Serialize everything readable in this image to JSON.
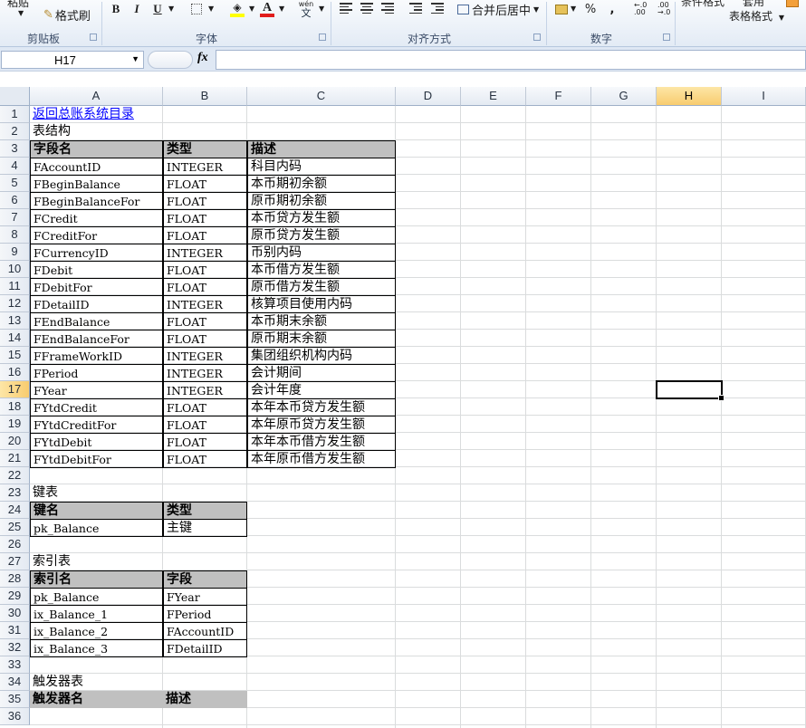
{
  "ribbon": {
    "paste_label": "粘贴",
    "format_painter_label": "格式刷",
    "bold": "B",
    "italic": "I",
    "underline": "U",
    "font_color_glyph": "A",
    "phonetic_glyph": "wén",
    "merge_center_label": "合并后居中",
    "percent": "%",
    "comma": ",",
    "cond_format_label": "条件格式",
    "apply_label": "套用",
    "table_format_label": "表格格式",
    "groups": {
      "clipboard": "剪贴板",
      "font": "字体",
      "alignment": "对齐方式",
      "number": "数字"
    }
  },
  "formula_bar": {
    "name_box": "H17",
    "fx": "fx",
    "formula": ""
  },
  "columns": [
    "A",
    "B",
    "C",
    "D",
    "E",
    "F",
    "G",
    "H",
    "I"
  ],
  "selected_column": "H",
  "selected_row": 17,
  "rows": [
    "1",
    "2",
    "3",
    "4",
    "5",
    "6",
    "7",
    "8",
    "9",
    "10",
    "11",
    "12",
    "13",
    "14",
    "15",
    "16",
    "17",
    "18",
    "19",
    "20",
    "21",
    "22",
    "23",
    "24",
    "25",
    "26",
    "27",
    "28",
    "29",
    "30",
    "31",
    "32",
    "33",
    "34",
    "35",
    "36"
  ],
  "sheet": {
    "link": "返回总账系统目录",
    "structure_title": "表结构",
    "structure_headers": [
      "字段名",
      "类型",
      "描述"
    ],
    "structure_rows": [
      [
        "FAccountID",
        "INTEGER",
        "科目内码"
      ],
      [
        "FBeginBalance",
        "FLOAT",
        "本币期初余额"
      ],
      [
        "FBeginBalanceFor",
        "FLOAT",
        "原币期初余额"
      ],
      [
        "FCredit",
        "FLOAT",
        "本币贷方发生额"
      ],
      [
        "FCreditFor",
        "FLOAT",
        "原币贷方发生额"
      ],
      [
        "FCurrencyID",
        "INTEGER",
        "币别内码"
      ],
      [
        "FDebit",
        "FLOAT",
        "本币借方发生额"
      ],
      [
        "FDebitFor",
        "FLOAT",
        "原币借方发生额"
      ],
      [
        "FDetailID",
        "INTEGER",
        "核算项目使用内码"
      ],
      [
        "FEndBalance",
        "FLOAT",
        "本币期末余额"
      ],
      [
        "FEndBalanceFor",
        "FLOAT",
        "原币期末余额"
      ],
      [
        "FFrameWorkID",
        "INTEGER",
        "集团组织机构内码"
      ],
      [
        "FPeriod",
        "INTEGER",
        "会计期间"
      ],
      [
        "FYear",
        "INTEGER",
        "会计年度"
      ],
      [
        "FYtdCredit",
        "FLOAT",
        "本年本币贷方发生额"
      ],
      [
        "FYtdCreditFor",
        "FLOAT",
        "本年原币贷方发生额"
      ],
      [
        "FYtdDebit",
        "FLOAT",
        "本年本币借方发生额"
      ],
      [
        "FYtdDebitFor",
        "FLOAT",
        "本年原币借方发生额"
      ]
    ],
    "key_title": "键表",
    "key_headers": [
      "键名",
      "类型"
    ],
    "key_rows": [
      [
        "pk_Balance",
        "主键"
      ]
    ],
    "index_title": "索引表",
    "index_headers": [
      "索引名",
      "字段"
    ],
    "index_rows": [
      [
        "pk_Balance",
        "FYear"
      ],
      [
        "ix_Balance_1",
        "FPeriod"
      ],
      [
        "ix_Balance_2",
        "FAccountID"
      ],
      [
        "ix_Balance_3",
        "FDetailID"
      ]
    ],
    "trigger_title": "触发器表",
    "trigger_headers": [
      "触发器名",
      "描述"
    ]
  }
}
